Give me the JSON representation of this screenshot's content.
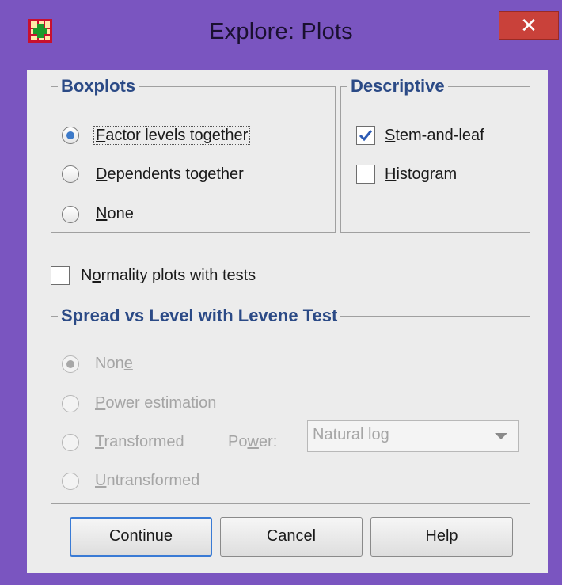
{
  "window": {
    "title": "Explore: Plots",
    "close_glyph": "✕",
    "app_icon": "spss-grid-icon"
  },
  "boxplots": {
    "legend": "Boxplots",
    "options": [
      {
        "pre": "",
        "key": "F",
        "post": "actor levels together",
        "selected": true
      },
      {
        "pre": "",
        "key": "D",
        "post": "ependents together",
        "selected": false
      },
      {
        "pre": "",
        "key": "N",
        "post": "one",
        "selected": false
      }
    ]
  },
  "descriptive": {
    "legend": "Descriptive",
    "items": [
      {
        "pre": "",
        "key": "S",
        "post": "tem-and-leaf",
        "checked": true
      },
      {
        "pre": "",
        "key": "H",
        "post": "istogram",
        "checked": false
      }
    ]
  },
  "normality": {
    "pre": "N",
    "key": "o",
    "post": "rmality plots with tests",
    "checked": false
  },
  "spread": {
    "legend": "Spread vs Level with Levene Test",
    "options": [
      {
        "pre": "Non",
        "key": "e",
        "post": "",
        "selected": true
      },
      {
        "pre": "",
        "key": "P",
        "post": "ower estimation",
        "selected": false
      },
      {
        "pre": "",
        "key": "T",
        "post": "ransformed",
        "selected": false
      },
      {
        "pre": "",
        "key": "U",
        "post": "ntransformed",
        "selected": false
      }
    ],
    "power_label": {
      "pre": "Po",
      "key": "w",
      "post": "er:"
    },
    "power_value": "Natural log"
  },
  "buttons": {
    "continue": "Continue",
    "cancel": "Cancel",
    "help": "Help"
  },
  "colors": {
    "titlebar": "#7a55c0",
    "close": "#c9413a",
    "legend_text": "#2b4a86"
  }
}
